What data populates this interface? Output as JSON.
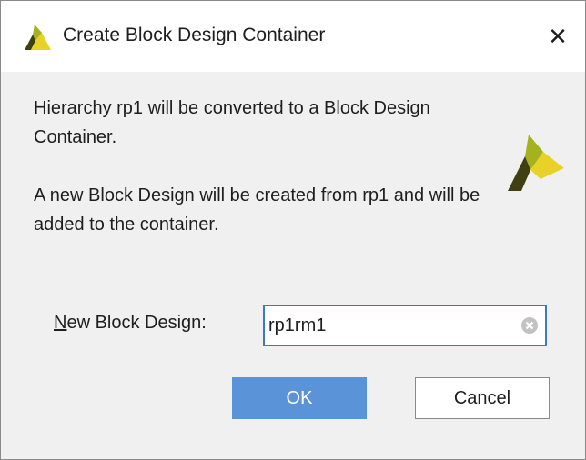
{
  "window": {
    "title": "Create Block Design Container",
    "close_glyph": "✕",
    "icon": "vivado-logo-icon"
  },
  "message": {
    "line1": "Hierarchy rp1 will be converted to a Block Design Container.",
    "line2": "A new Block Design will be created from rp1 and will be added to the container."
  },
  "field": {
    "label_mnemonic": "N",
    "label_rest": "ew Block Design:",
    "value": "rp1rm1"
  },
  "buttons": {
    "ok": "OK",
    "cancel": "Cancel"
  },
  "colors": {
    "logo_light": "#e8d228",
    "logo_mid": "#a3b21e",
    "logo_dark": "#3f3f12",
    "accent": "#5a93d8",
    "focus_border": "#3c78c8"
  }
}
